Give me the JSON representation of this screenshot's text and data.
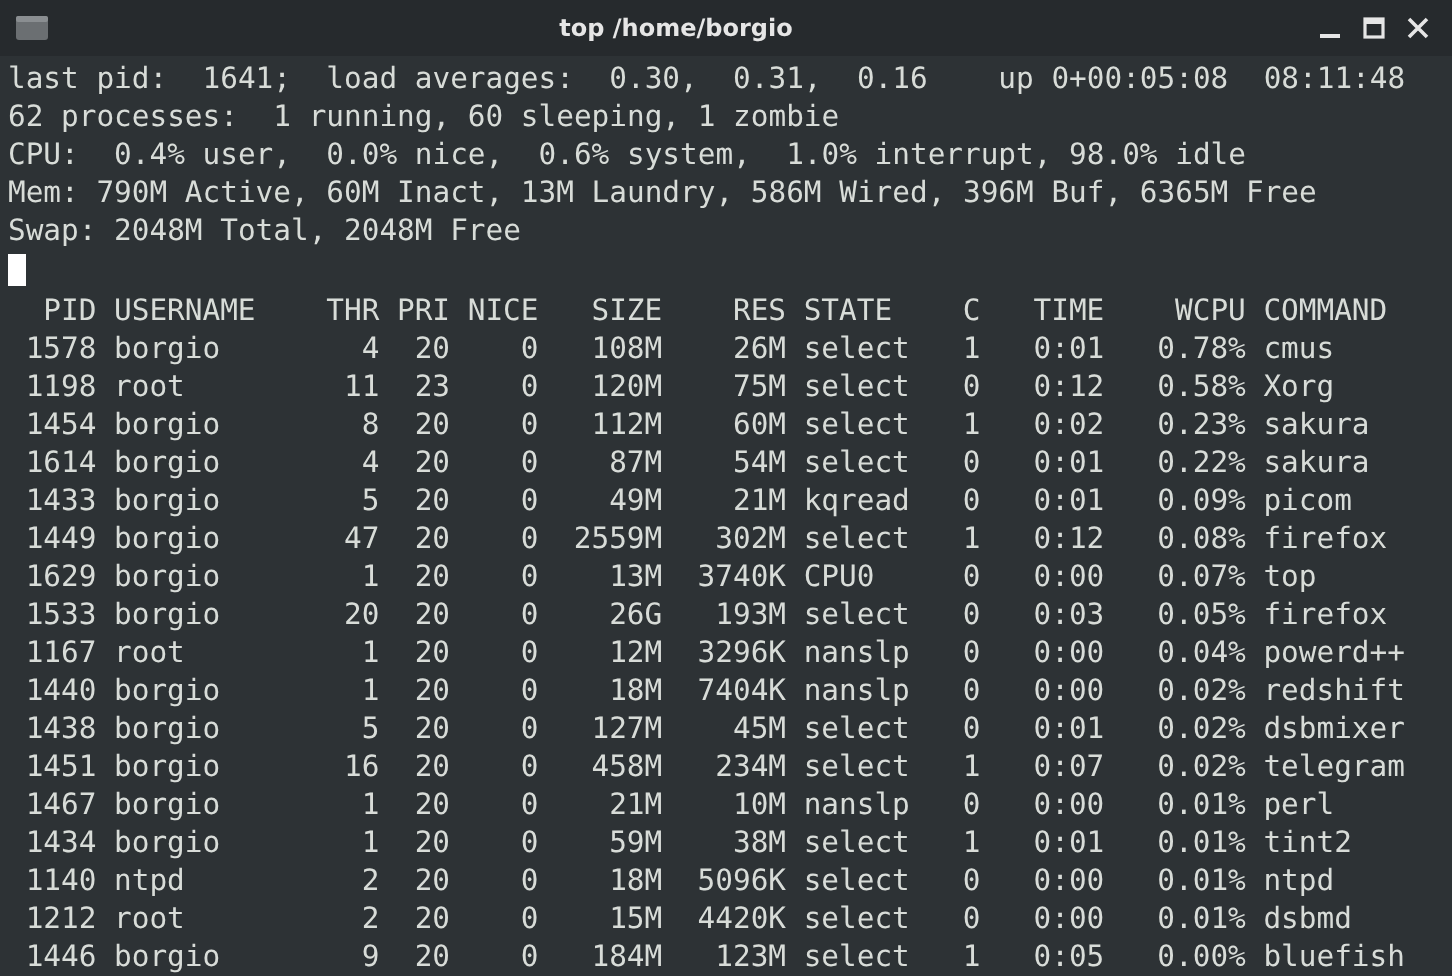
{
  "window": {
    "title": "top /home/borgio"
  },
  "summary_lines": [
    "last pid:  1641;  load averages:  0.30,  0.31,  0.16    up 0+00:05:08  08:11:48",
    "62 processes:  1 running, 60 sleeping, 1 zombie",
    "CPU:  0.4% user,  0.0% nice,  0.6% system,  1.0% interrupt, 98.0% idle",
    "Mem: 790M Active, 60M Inact, 13M Laundry, 586M Wired, 396M Buf, 6365M Free",
    "Swap: 2048M Total, 2048M Free"
  ],
  "table": {
    "columns": [
      "PID",
      "USERNAME",
      "THR",
      "PRI",
      "NICE",
      "SIZE",
      "RES",
      "STATE",
      "C",
      "TIME",
      "WCPU",
      "COMMAND"
    ],
    "rows": [
      [
        "1578",
        "borgio",
        "4",
        "20",
        "0",
        "108M",
        "26M",
        "select",
        "1",
        "0:01",
        "0.78%",
        "cmus"
      ],
      [
        "1198",
        "root",
        "11",
        "23",
        "0",
        "120M",
        "75M",
        "select",
        "0",
        "0:12",
        "0.58%",
        "Xorg"
      ],
      [
        "1454",
        "borgio",
        "8",
        "20",
        "0",
        "112M",
        "60M",
        "select",
        "1",
        "0:02",
        "0.23%",
        "sakura"
      ],
      [
        "1614",
        "borgio",
        "4",
        "20",
        "0",
        "87M",
        "54M",
        "select",
        "0",
        "0:01",
        "0.22%",
        "sakura"
      ],
      [
        "1433",
        "borgio",
        "5",
        "20",
        "0",
        "49M",
        "21M",
        "kqread",
        "0",
        "0:01",
        "0.09%",
        "picom"
      ],
      [
        "1449",
        "borgio",
        "47",
        "20",
        "0",
        "2559M",
        "302M",
        "select",
        "1",
        "0:12",
        "0.08%",
        "firefox"
      ],
      [
        "1629",
        "borgio",
        "1",
        "20",
        "0",
        "13M",
        "3740K",
        "CPU0",
        "0",
        "0:00",
        "0.07%",
        "top"
      ],
      [
        "1533",
        "borgio",
        "20",
        "20",
        "0",
        "26G",
        "193M",
        "select",
        "0",
        "0:03",
        "0.05%",
        "firefox"
      ],
      [
        "1167",
        "root",
        "1",
        "20",
        "0",
        "12M",
        "3296K",
        "nanslp",
        "0",
        "0:00",
        "0.04%",
        "powerd++"
      ],
      [
        "1440",
        "borgio",
        "1",
        "20",
        "0",
        "18M",
        "7404K",
        "nanslp",
        "0",
        "0:00",
        "0.02%",
        "redshift"
      ],
      [
        "1438",
        "borgio",
        "5",
        "20",
        "0",
        "127M",
        "45M",
        "select",
        "0",
        "0:01",
        "0.02%",
        "dsbmixer"
      ],
      [
        "1451",
        "borgio",
        "16",
        "20",
        "0",
        "458M",
        "234M",
        "select",
        "1",
        "0:07",
        "0.02%",
        "telegram"
      ],
      [
        "1467",
        "borgio",
        "1",
        "20",
        "0",
        "21M",
        "10M",
        "nanslp",
        "0",
        "0:00",
        "0.01%",
        "perl"
      ],
      [
        "1434",
        "borgio",
        "1",
        "20",
        "0",
        "59M",
        "38M",
        "select",
        "1",
        "0:01",
        "0.01%",
        "tint2"
      ],
      [
        "1140",
        "ntpd",
        "2",
        "20",
        "0",
        "18M",
        "5096K",
        "select",
        "0",
        "0:00",
        "0.01%",
        "ntpd"
      ],
      [
        "1212",
        "root",
        "2",
        "20",
        "0",
        "15M",
        "4420K",
        "select",
        "0",
        "0:00",
        "0.01%",
        "dsbmd"
      ],
      [
        "1446",
        "borgio",
        "9",
        "20",
        "0",
        "184M",
        "123M",
        "select",
        "1",
        "0:05",
        "0.00%",
        "bluefish"
      ]
    ]
  }
}
